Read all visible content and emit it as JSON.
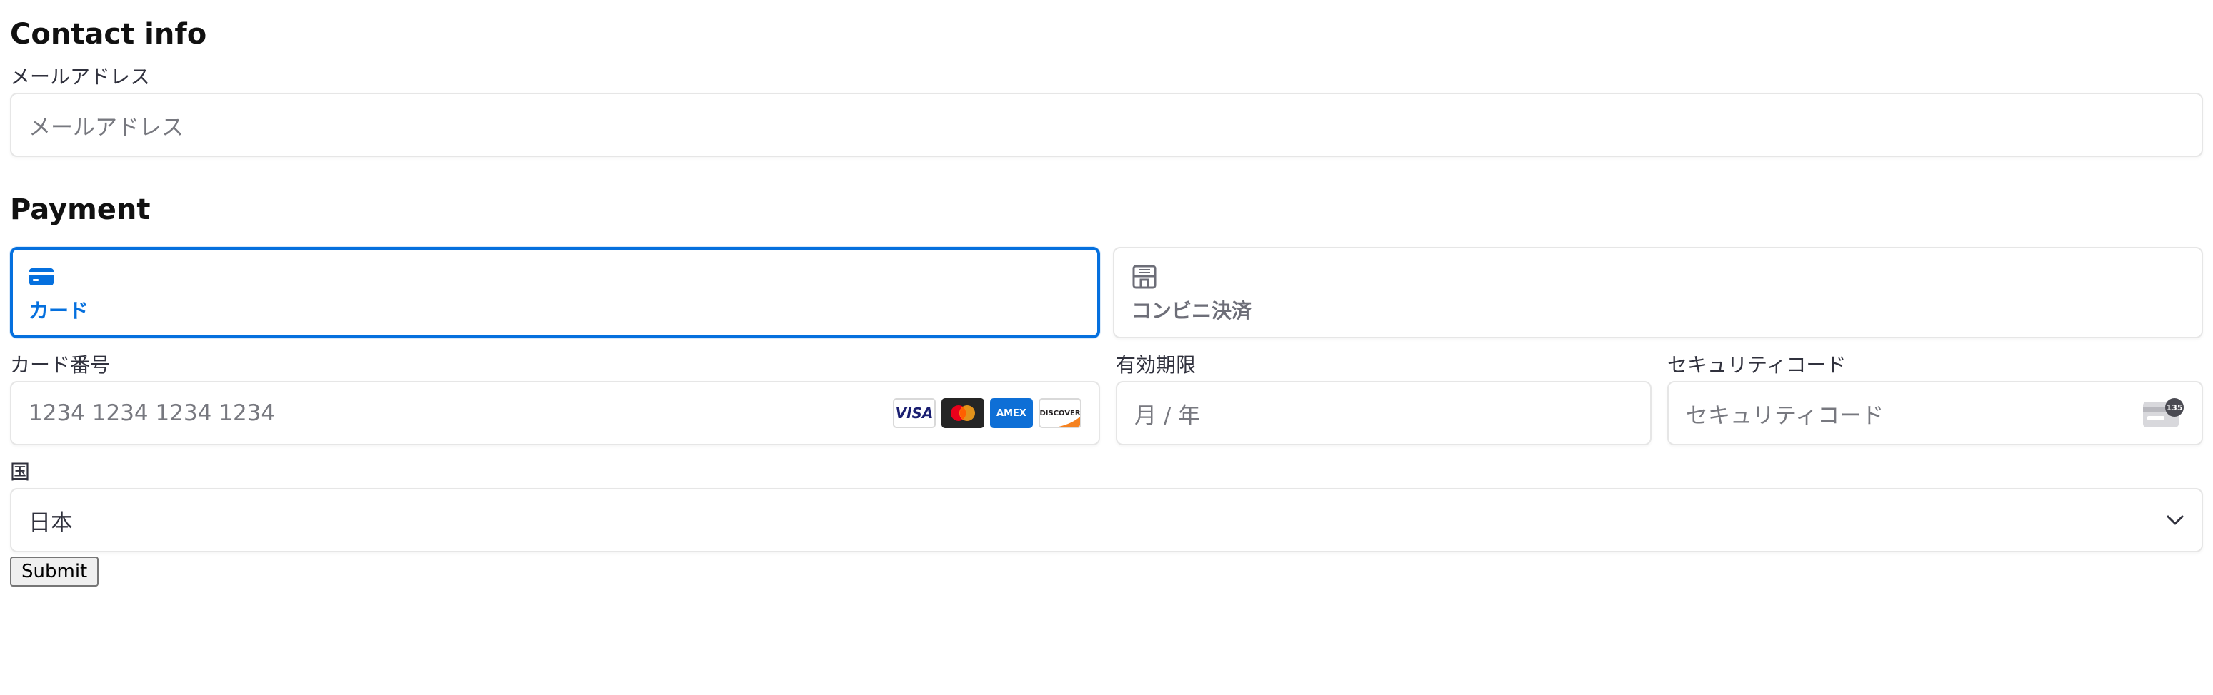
{
  "contact": {
    "title": "Contact info",
    "email_label": "メールアドレス",
    "email_placeholder": "メールアドレス"
  },
  "payment": {
    "title": "Payment",
    "tabs": [
      {
        "label": "カード",
        "icon": "card-icon",
        "selected": true
      },
      {
        "label": "コンビニ決済",
        "icon": "konbini-store-icon",
        "selected": false
      }
    ],
    "card_number_label": "カード番号",
    "card_number_placeholder": "1234 1234 1234 1234",
    "card_brands": [
      "VISA",
      "mastercard",
      "AMEX",
      "DISCOVER"
    ],
    "expiry_label": "有効期限",
    "expiry_placeholder": "月 / 年",
    "cvc_label": "セキュリティコード",
    "cvc_placeholder": "セキュリティコード",
    "cvc_icon_text": "135",
    "country_label": "国",
    "country_value": "日本"
  },
  "submit_label": "Submit",
  "colors": {
    "accent": "#0570de",
    "border": "#e6e6e6",
    "placeholder": "#77787f",
    "label": "#30313d"
  }
}
